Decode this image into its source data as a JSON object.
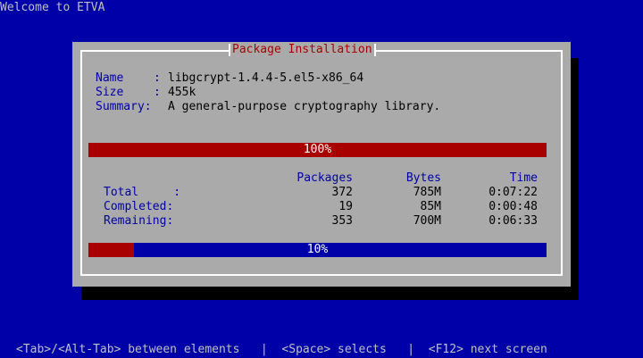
{
  "screen_title": "Welcome to ETVA",
  "dialog": {
    "title": "Package Installation",
    "name_label": "Name",
    "name_sep": ":",
    "name_value": "libgcrypt-1.4.4-5.el5-x86_64",
    "size_label": "Size",
    "size_sep": ":",
    "size_value": "455k",
    "summary_label": "Summary:",
    "summary_value": "A general-purpose cryptography library.",
    "package_progress": {
      "fraction": 1.0,
      "text": "100%"
    },
    "table": {
      "headers": [
        "Packages",
        "Bytes",
        "Time"
      ],
      "rows": [
        {
          "label": "Total     :",
          "packages": "372",
          "bytes": "785M",
          "time": "0:07:22"
        },
        {
          "label": "Completed:",
          "packages": "19",
          "bytes": "85M",
          "time": "0:00:48"
        },
        {
          "label": "Remaining:",
          "packages": "353",
          "bytes": "700M",
          "time": "0:06:33"
        }
      ]
    },
    "overall_progress": {
      "fraction": 0.1,
      "text": "10%"
    }
  },
  "footer": "<Tab>/<Alt-Tab> between elements   |  <Space> selects   |  <F12> next screen",
  "colors": {
    "background": "#0000a8",
    "dialog": "#aaaaaa",
    "title": "#a80000",
    "progress_fill": "#a80000",
    "progress_track": "#0000a8"
  }
}
